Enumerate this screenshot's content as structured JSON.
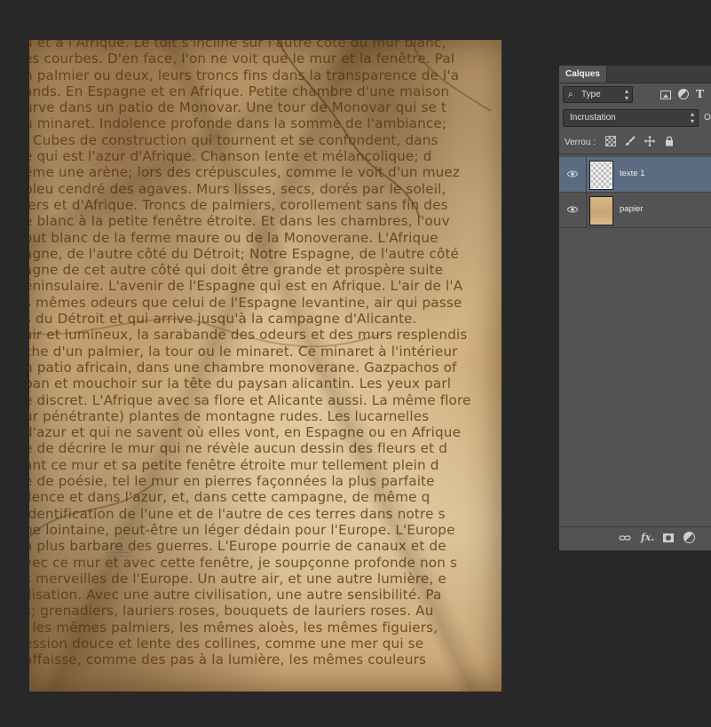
{
  "canvas": {
    "text_lines": [
      "u et à l'Afrique. Le toit s'incline sur l'autre côté du mur blanc,",
      "es courbes. D'en face, l'on ne voit que le mur et la fenêtre. Pal",
      "n palmier ou deux, leurs troncs fins dans la transparence de l'a",
      "ands. En Espagne et en Afrique. Petite chambre d'une maison",
      "urve dans un patio de Monovar. Une tour de Monovar qui se t",
      "u minaret. Indolence profonde dans la somme de l'ambiance;",
      ". Cubes de construction qui tournent et se confondent, dans",
      "é qui est l'azur d'Afrique. Chanson lente et mélancolique; d",
      "ême une arène; lors des crépuscules, comme le voit d'un muez",
      "bleu cendré des agaves. Murs lisses, secs, dorés par le soleil,",
      "iers et d'Afrique. Troncs de palmiers, corollement sans fin des",
      "e blanc à la petite fenêtre étroite. Et dans les chambres, l'ouv",
      "out blanc de la ferme maure ou de la Monoverane. L'Afrique",
      "agne, de l'autre côté du Détroit; Notre Espagne, de l'autre côté",
      "agne de cet autre côté qui doit être grande et prospère suite",
      "éninsulaire. L'avenir de l'Espagne qui est en Afrique. L'air de l'A",
      "s mêmes odeurs que celui de l'Espagne levantine, air qui passe",
      "s du Détroit et qui arrive jusqu'à la campagne d'Alicante.",
      "air et lumineux, la sarabande des odeurs et des murs resplendis",
      "che d'un palmier, la tour ou le minaret. Ce minaret à l'intérieur",
      "n patio africain, dans une chambre monoverane. Gazpachos of",
      "ban et mouchoir sur la tête du paysan alicantin. Les yeux parl",
      "e discret. L'Afrique avec sa flore et Alicante aussi. La même flore",
      "ur pénétrante) plantes de montagne rudes. Les lucarnelles",
      "d'azur et qui ne savent où elles vont, en Espagne ou en Afrique",
      "e de décrire le mur qui ne révèle aucun dessin des fleurs et d",
      "ant ce mur et sa petite fenêtre étroite mur tellement plein d",
      "e de poésie, tel le mur en pierres façonnées la plus parfaite",
      "ilence et dans l'azur, et, dans cette campagne, de même q",
      "Identification de l'une et de l'autre de ces terres dans notre s",
      "pe lointaine, peut-être un léger dédain pour l'Europe. L'Europe",
      "a plus barbare des guerres. L'Europe pourrie de canaux et de",
      "vec ce mur et avec cette fenêtre, je soupçonne profonde non s",
      "s merveilles de l'Europe. Un autre air, et une autre lumière, e",
      "ilisation. Avec une autre civilisation, une autre sensibilité. Pa",
      "s; grenadiers, lauriers roses, bouquets de lauriers roses. Au",
      "i les mêmes palmiers, les mêmes aloès, les mêmes figuiers,",
      "ession douce et lente des collines, comme une mer qui se",
      "affaisse, comme des pas à la lumière, les mêmes couleurs"
    ]
  },
  "layers_panel": {
    "tab_title": "Calques",
    "filter": {
      "value": "Type",
      "search_glyph": "⌕"
    },
    "filter_icons": [
      "image-filter-icon",
      "adjustment-filter-icon",
      "type-filter-icon"
    ],
    "type_filter_glyph": "T",
    "blend_mode": "Incrustation",
    "opacity_label": "Op",
    "lock_label": "Verrou :",
    "layers": [
      {
        "name": "texte 1",
        "selected": true,
        "visible": true,
        "thumb": "transparent"
      },
      {
        "name": "papier",
        "selected": false,
        "visible": true,
        "thumb": "paper"
      }
    ],
    "footer": {
      "fx_label": "fx."
    },
    "colors": {
      "panel_bg": "#535353",
      "selected_row": "#5a6b82",
      "workspace_bg": "#282828"
    }
  }
}
